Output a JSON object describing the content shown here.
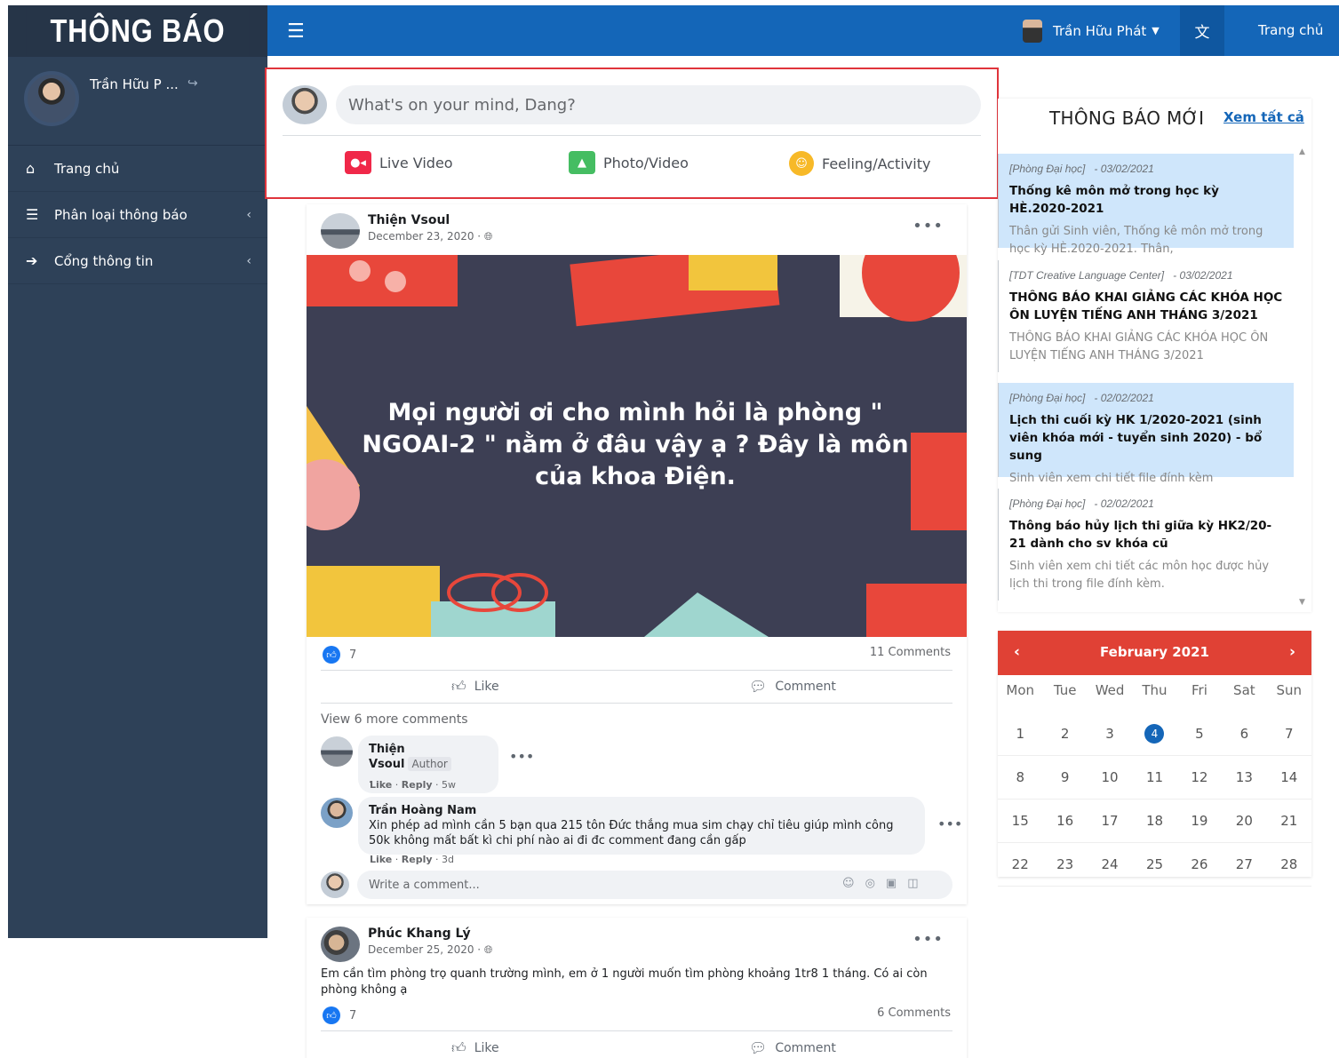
{
  "sidebar": {
    "brand": "THÔNG BÁO",
    "user_name": "Trần Hữu P ...",
    "items": [
      {
        "label": "Trang chủ",
        "icon": "home-icon"
      },
      {
        "label": "Phân loại thông báo",
        "icon": "list-icon"
      },
      {
        "label": "Cổng thông tin",
        "icon": "sign-in-icon"
      }
    ]
  },
  "topbar": {
    "user_name": "Trần Hữu Phát",
    "home_label": "Trang chủ"
  },
  "composer": {
    "placeholder": "What's on your mind, Dang?",
    "live_video": "Live Video",
    "photo_video": "Photo/Video",
    "feeling": "Feeling/Activity"
  },
  "posts": [
    {
      "author": "Thiện Vsoul",
      "date": "December 23, 2020 · ",
      "image_text": "Mọi người ơi cho mình hỏi là phòng \" NGOAI-2 \" nằm ở đâu vậy ạ ? Đây là môn của khoa Điện.",
      "likes": "7",
      "comments_count": "11 Comments",
      "like_label": "Like",
      "comment_label": "Comment",
      "view_more": "View 6 more comments",
      "comments": [
        {
          "author": "Thiện Vsoul",
          "tag": "Author",
          "text": ".",
          "like": "Like",
          "reply": "Reply",
          "time": " · 5w"
        },
        {
          "author": "Trần Hoàng Nam",
          "text": "Xin phép ad mình cần 5 bạn qua 215 tôn Đức thắng mua sim chạy chỉ tiêu giúp mình công 50k không mất bất kì chi phí nào ai đi đc comment đang cần gấp",
          "like": "Like",
          "reply": "Reply",
          "time": " · 3d"
        }
      ],
      "write_placeholder": "Write a comment..."
    },
    {
      "author": "Phúc Khang Lý",
      "date": "December 25, 2020 · ",
      "text": "Em cần tìm phòng trọ quanh trường mình, em ở 1 người muốn tìm phòng khoảng 1tr8 1 tháng. Có ai còn phòng không ạ",
      "likes": "7",
      "comments_count": "6 Comments",
      "like_label": "Like",
      "comment_label": "Comment"
    }
  ],
  "news": {
    "title": "THÔNG BÁO MỚI",
    "see_all": "Xem tất cả",
    "items": [
      {
        "source": "[Phòng Đại học]",
        "date": "- 03/02/2021",
        "title": "Thống kê môn mở trong học kỳ HÈ.2020-2021",
        "desc": "Thân gửi Sinh viên, Thống kê môn mở trong học kỳ HÈ.2020-2021. Thân,"
      },
      {
        "source": "[TDT Creative Language Center]",
        "date": "- 03/02/2021",
        "title": "THÔNG BÁO KHAI GIẢNG CÁC KHÓA HỌC ÔN LUYỆN TIẾNG ANH THÁNG 3/2021",
        "desc": "THÔNG BÁO KHAI GIẢNG CÁC KHÓA HỌC ÔN LUYỆN TIẾNG ANH THÁNG 3/2021"
      },
      {
        "source": "[Phòng Đại học]",
        "date": "- 02/02/2021",
        "title": "Lịch thi cuối kỳ HK 1/2020-2021 (sinh viên khóa mới - tuyển sinh 2020) - bổ sung",
        "desc": "Sinh viên xem chi tiết file đính kèm"
      },
      {
        "source": "[Phòng Đại học]",
        "date": "- 02/02/2021",
        "title": "Thông báo hủy lịch thi giữa kỳ HK2/20-21 dành cho sv khóa cũ",
        "desc": "Sinh viên xem chi tiết các môn học được hủy lịch thi trong file đính kèm."
      }
    ]
  },
  "calendar": {
    "title": "February 2021",
    "weekdays": [
      "Mon",
      "Tue",
      "Wed",
      "Thu",
      "Fri",
      "Sat",
      "Sun"
    ],
    "days": [
      "1",
      "2",
      "3",
      "4",
      "5",
      "6",
      "7",
      "8",
      "9",
      "10",
      "11",
      "12",
      "13",
      "14",
      "15",
      "16",
      "17",
      "18",
      "19",
      "20",
      "21",
      "22",
      "23",
      "24",
      "25",
      "26",
      "27",
      "28"
    ],
    "today": "4"
  }
}
